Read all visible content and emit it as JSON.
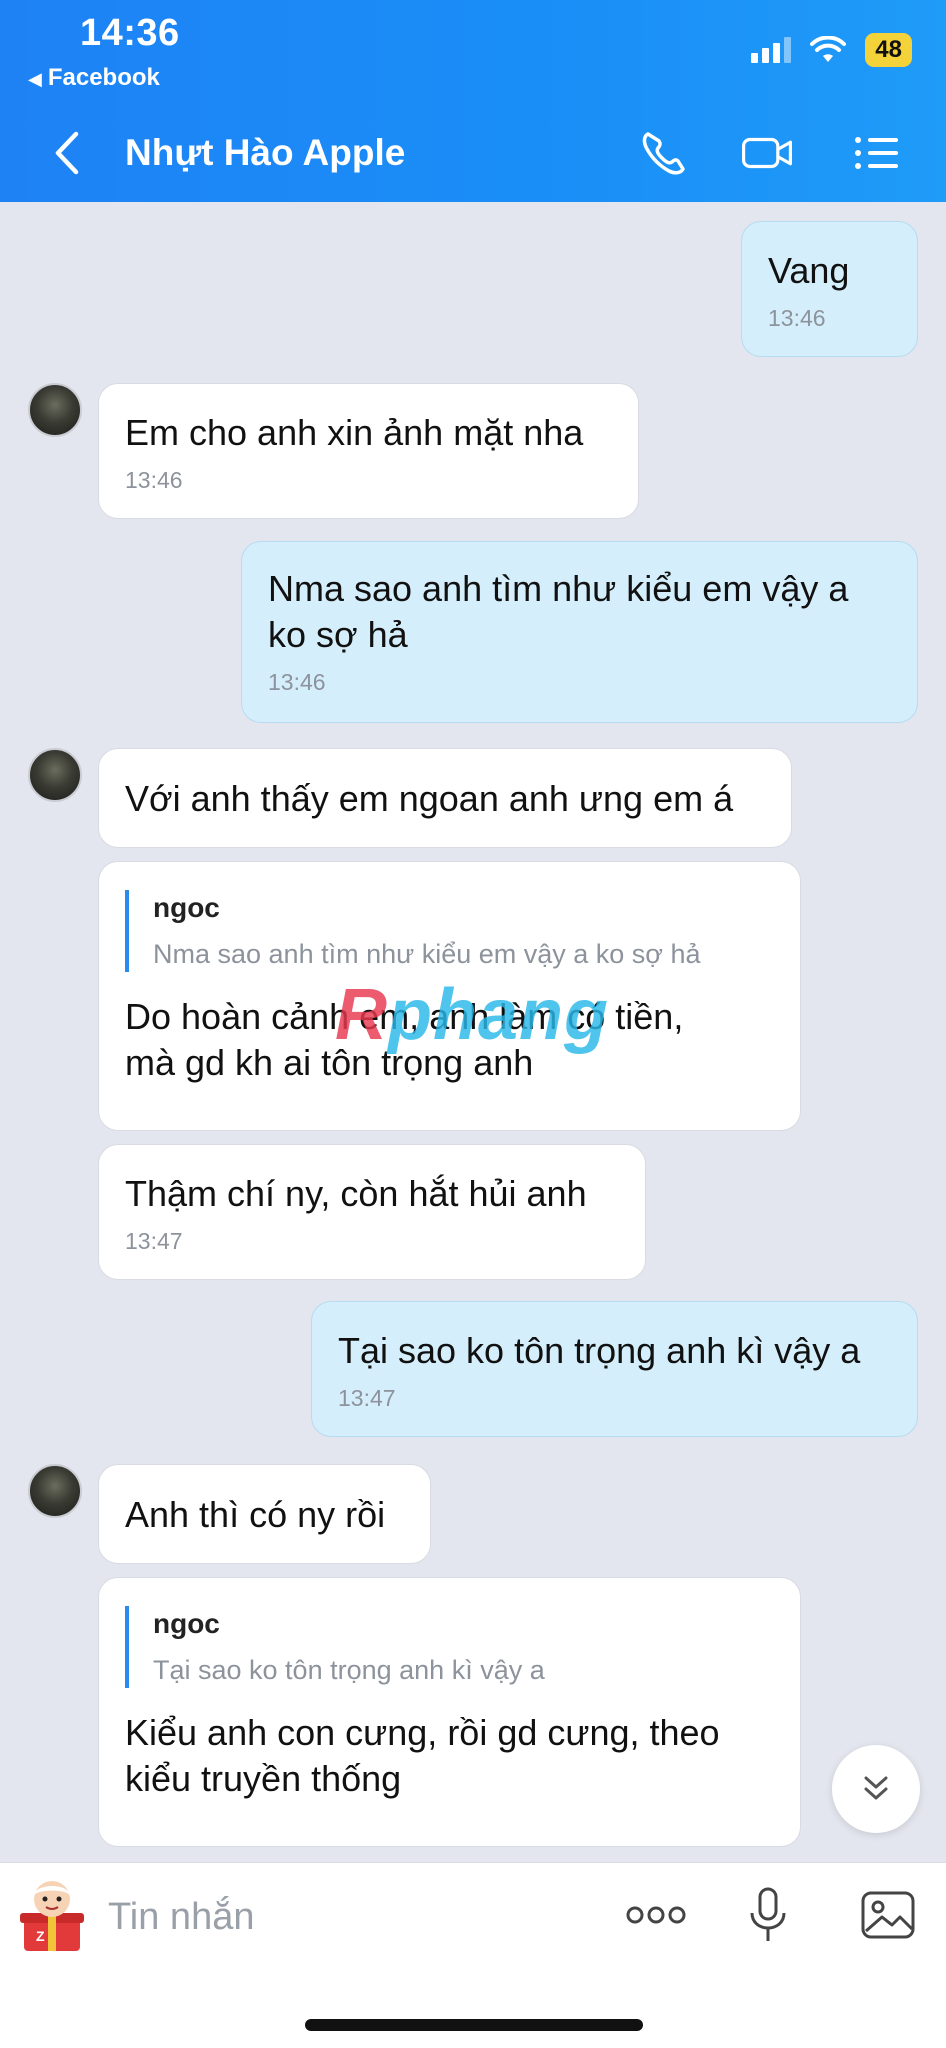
{
  "status_bar": {
    "time": "14:36",
    "back_app": "Facebook",
    "battery": "48"
  },
  "header": {
    "contact_name": "Nhựt Hào Apple"
  },
  "messages": [
    {
      "text": "Vang",
      "time": "13:46"
    },
    {
      "text": "Em cho anh xin ảnh mặt nha",
      "time": "13:46"
    },
    {
      "line1": "Nma sao anh tìm như kiểu em vậy a",
      "line2": "ko sợ hả",
      "time": "13:46"
    },
    {
      "text": "Với anh thấy em ngoan anh ưng em á"
    },
    {
      "quote_name": "ngoc",
      "quote_text": "Nma sao anh tìm như kiểu em vậy a ko sợ hả",
      "line1": "Do hoàn cảnh em, anh làm có tiền,",
      "line2": "mà gd kh ai tôn trọng anh"
    },
    {
      "text": "Thậm chí ny, còn hắt hủi anh",
      "time": "13:47"
    },
    {
      "text": "Tại sao ko tôn trọng anh kì vậy a",
      "time": "13:47"
    },
    {
      "text": "Anh thì có ny rồi"
    },
    {
      "quote_name": "ngoc",
      "quote_text": "Tại sao ko tôn trọng anh kì vậy a",
      "line1": "Kiểu anh con cưng, rồi gd cưng, theo",
      "line2": "kiểu truyền thống"
    }
  ],
  "watermark": {
    "part1": "R",
    "part2": "phang"
  },
  "input": {
    "placeholder": "Tin nhắn"
  },
  "colors": {
    "header_blue": "#1e82f5",
    "outgoing_bubble": "#d5eefb",
    "incoming_bubble": "#ffffff",
    "background": "#e3e6ee",
    "quote_bar": "#2a8bef"
  }
}
